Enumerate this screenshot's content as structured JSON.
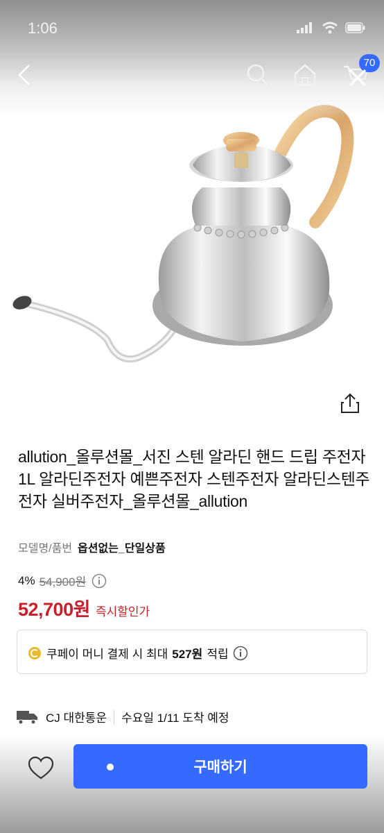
{
  "status": {
    "time": "1:06"
  },
  "nav": {
    "cart_count": "70"
  },
  "product": {
    "title": "allution_올루션몰_서진 스텐 알라딘 핸드 드립 주전자 1L 알라딘주전자 예쁜주전자 스텐주전자 알라딘스텐주전자 실버주전자_올루션몰_allution",
    "model_label": "모델명/품번",
    "model_value": "옵션없는_단일상품"
  },
  "price": {
    "discount": "4%",
    "original": "54,900원",
    "sale": "52,700원",
    "sale_tag": "즉시할인가"
  },
  "coupay": {
    "prefix": "쿠페이 머니 결제 시 최대",
    "amount": "527원",
    "suffix": "적립"
  },
  "delivery": {
    "carrier": "CJ 대한통운",
    "arrival": "수요일 1/11 도착 예정"
  },
  "actions": {
    "buy_label": "구매하기"
  },
  "colors": {
    "accent": "#346aff",
    "price": "#c8202a"
  },
  "icons": [
    "back-icon",
    "search-icon",
    "home-icon",
    "cart-icon",
    "close-icon",
    "share-icon",
    "info-icon",
    "coin-icon",
    "truck-icon",
    "heart-icon"
  ]
}
